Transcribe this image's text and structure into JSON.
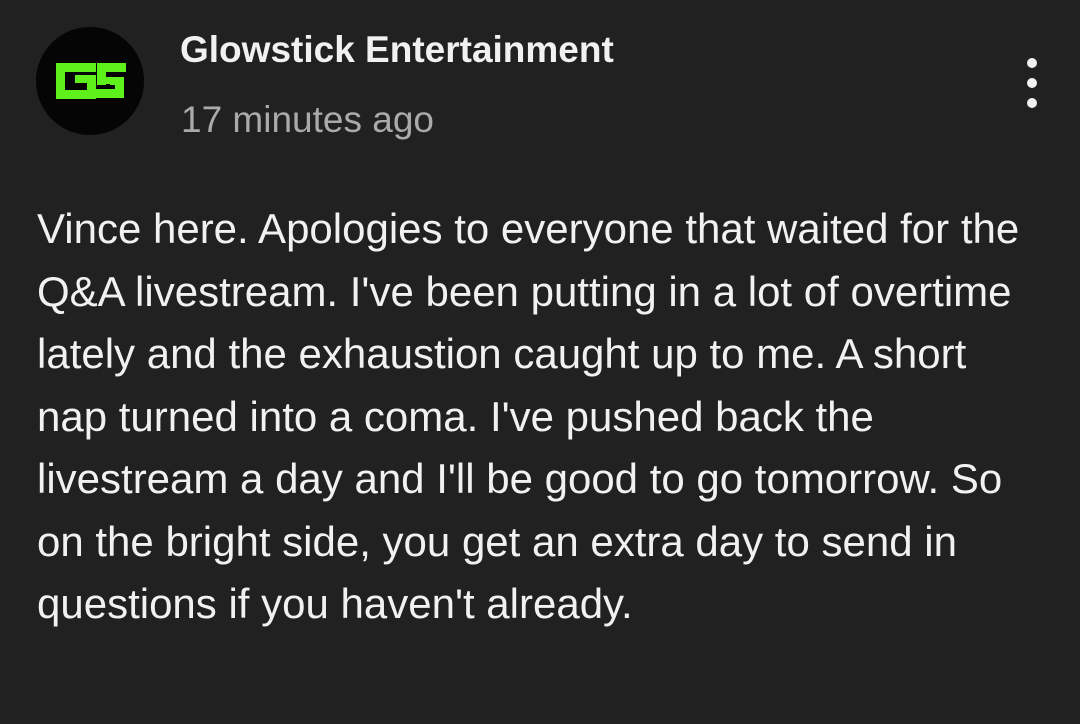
{
  "post": {
    "channel_name": "Glowstick Entertainment",
    "timestamp": "17 minutes ago",
    "avatar": {
      "logo_text": "GS",
      "logo_color": "#5ef01a",
      "background": "#050505"
    },
    "menu_icon": "more-vert-icon",
    "text": "Vince here. Apologies to everyone that waited for the Q&A livestream. I've been putting in a lot of overtime lately and the exhaustion caught up to me. A short nap turned into a coma. I've pushed back the livestream a day and I'll be good to go tomorrow. So on the bright side, you get an extra day to send in questions if you haven't already."
  },
  "colors": {
    "background": "#212121",
    "primary_text": "#f1f1f1",
    "secondary_text": "#aaaaaa",
    "accent_green": "#5ef01a"
  }
}
